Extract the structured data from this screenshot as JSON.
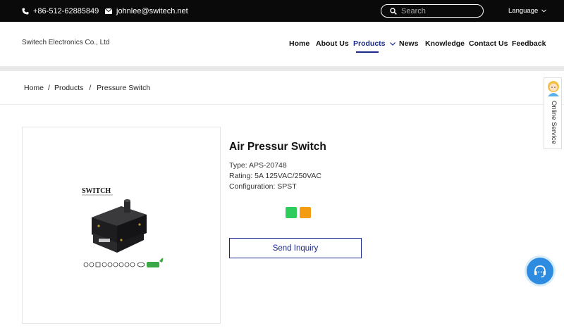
{
  "topbar": {
    "phone": "+86-512-62885849",
    "email": "johnlee@switech.net",
    "search_placeholder": "Search",
    "language_label": "Language"
  },
  "header": {
    "brand": "Switech Electronics Co., Ltd",
    "nav": [
      {
        "label": "Home"
      },
      {
        "label": "About Us"
      },
      {
        "label": "Products",
        "active": true
      },
      {
        "label": "News"
      },
      {
        "label": "Knowledge"
      },
      {
        "label": "Contact Us"
      },
      {
        "label": "Feedback"
      }
    ]
  },
  "breadcrumb": [
    "Home",
    "Products",
    "Pressure Switch"
  ],
  "product": {
    "title": "Air Pressur Switch",
    "type": "Type: APS-20748",
    "rating": "Rating: 5A 125VAC/250VAC",
    "configuration": "Configuration: SPST",
    "image_logo": "SWITCH",
    "color_options": [
      "#2ecc5a",
      "#f39c12"
    ],
    "inquiry_label": "Send Inquiry"
  },
  "sidebar": {
    "online_service": "Online Service"
  },
  "colors": {
    "accent": "#1a2a8a",
    "topbar": "#0a0a0a",
    "chat": "#2d8be0"
  }
}
